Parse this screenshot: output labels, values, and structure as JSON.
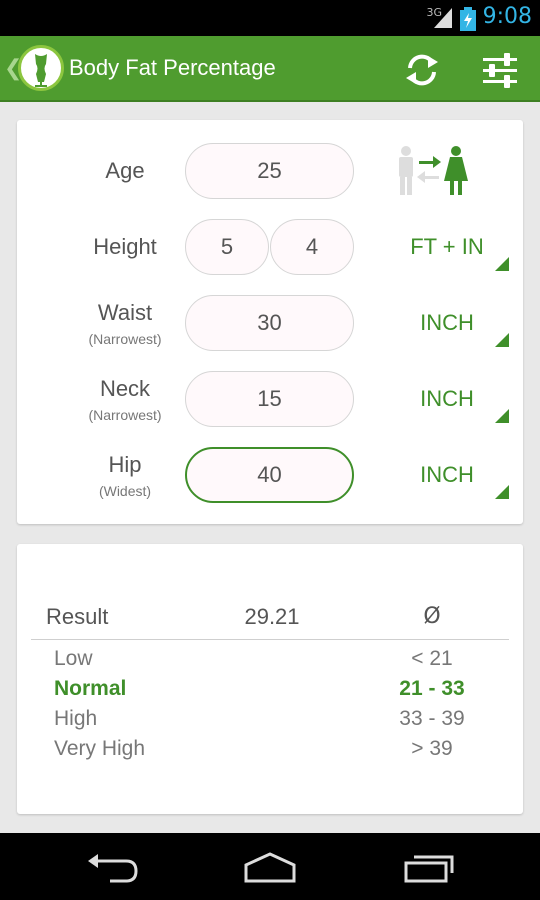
{
  "status_bar": {
    "network": "3G",
    "time": "9:08"
  },
  "header": {
    "title": "Body Fat Percentage"
  },
  "form": {
    "age": {
      "label": "Age",
      "value": "25"
    },
    "height": {
      "label": "Height",
      "feet": "5",
      "inches": "4",
      "unit": "FT + IN"
    },
    "waist": {
      "label": "Waist",
      "sublabel": "(Narrowest)",
      "value": "30",
      "unit": "INCH"
    },
    "neck": {
      "label": "Neck",
      "sublabel": "(Narrowest)",
      "value": "15",
      "unit": "INCH"
    },
    "hip": {
      "label": "Hip",
      "sublabel": "(Widest)",
      "value": "40",
      "unit": "INCH"
    }
  },
  "result": {
    "label": "Result",
    "value": "29.21",
    "symbol": "Ø",
    "ranges": [
      {
        "name": "Low",
        "value": "< 21",
        "highlighted": false
      },
      {
        "name": "Normal",
        "value": "21 - 33",
        "highlighted": true
      },
      {
        "name": "High",
        "value": "33 - 39",
        "highlighted": false
      },
      {
        "name": "Very High",
        "value": "> 39",
        "highlighted": false
      }
    ]
  },
  "colors": {
    "action_bar": "#4f9c2f",
    "accent": "#3f8f2a",
    "clock": "#33b5e5"
  },
  "icons": [
    "app-logo-icon",
    "refresh-icon",
    "settings-sliders-icon",
    "gender-switch-icon",
    "back-icon",
    "home-icon",
    "recent-apps-icon"
  ]
}
